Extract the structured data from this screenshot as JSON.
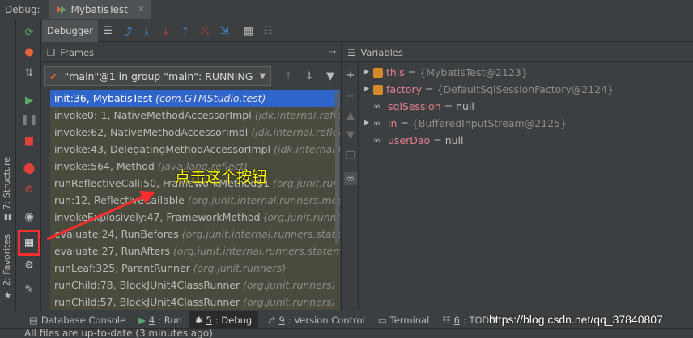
{
  "topbar": {
    "label": "Debug:",
    "tab_title": "MybatisTest",
    "tab_close": "✕"
  },
  "leftstrip": {
    "structure": "7: Structure",
    "favorites": "2: Favorites"
  },
  "debugger_tab": "Debugger",
  "frames": {
    "title": "Frames",
    "thread": "\"main\"@1 in group \"main\": RUNNING",
    "items": [
      {
        "method": "init:36, MybatisTest",
        "pkg": "(com.GTMStudio.test)"
      },
      {
        "method": "invoke0:-1, NativeMethodAccessorImpl",
        "pkg": "(jdk.internal.reflect)"
      },
      {
        "method": "invoke:62, NativeMethodAccessorImpl",
        "pkg": "(jdk.internal.reflect)"
      },
      {
        "method": "invoke:43, DelegatingMethodAccessorImpl",
        "pkg": "(jdk.internal.reflect)"
      },
      {
        "method": "invoke:564, Method",
        "pkg": "(java.lang.reflect)"
      },
      {
        "method": "runReflectiveCall:50, FrameworkMethod$1",
        "pkg": "(org.junit.runners.m)"
      },
      {
        "method": "run:12, ReflectiveCallable",
        "pkg": "(org.junit.internal.runners.model)"
      },
      {
        "method": "invokeExplosively:47, FrameworkMethod",
        "pkg": "(org.junit.runners.m)"
      },
      {
        "method": "evaluate:24, RunBefores",
        "pkg": "(org.junit.internal.runners.statements)"
      },
      {
        "method": "evaluate:27, RunAfters",
        "pkg": "(org.junit.internal.runners.statements)"
      },
      {
        "method": "runLeaf:325, ParentRunner",
        "pkg": "(org.junit.runners)"
      },
      {
        "method": "runChild:78, BlockJUnit4ClassRunner",
        "pkg": "(org.junit.runners)"
      },
      {
        "method": "runChild:57, BlockJUnit4ClassRunner",
        "pkg": "(org.junit.runners)"
      }
    ]
  },
  "variables": {
    "title": "Variables",
    "items": [
      {
        "name": "this",
        "value": "{MybatisTest@2123}",
        "kind": "field",
        "expand": true
      },
      {
        "name": "factory",
        "value": "{DefaultSqlSessionFactory@2124}",
        "kind": "field",
        "expand": true
      },
      {
        "name": "sqlSession",
        "value": "null",
        "kind": "watch",
        "expand": false
      },
      {
        "name": "in",
        "value": "{BufferedInputStream@2125}",
        "kind": "watch",
        "expand": true
      },
      {
        "name": "userDao",
        "value": "null",
        "kind": "watch",
        "expand": false
      }
    ]
  },
  "bottombar": {
    "tabs": [
      {
        "num": "",
        "label": "Database Console"
      },
      {
        "num": "4",
        "label": ": Run"
      },
      {
        "num": "5",
        "label": ": Debug"
      },
      {
        "num": "9",
        "label": ": Version Control"
      },
      {
        "num": "",
        "label": "Terminal"
      },
      {
        "num": "6",
        "label": ": TODO"
      }
    ],
    "status": "All files are up-to-date (3 minutes ago)"
  },
  "watermark": "https://blog.csdn.net/qq_37840807",
  "annotation": "点击这个按钮",
  "colors": {
    "accent": "#2f65ca",
    "highlight": "#ff2d2d",
    "annotation": "#ffff00"
  }
}
